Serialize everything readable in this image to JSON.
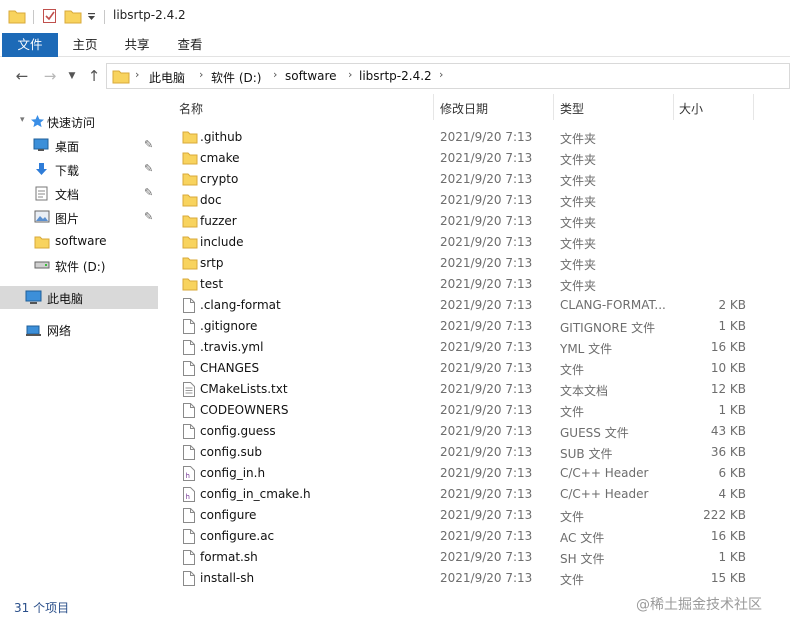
{
  "window": {
    "title": "libsrtp-2.4.2"
  },
  "ribbon": {
    "tabs": [
      "文件",
      "主页",
      "共享",
      "查看"
    ]
  },
  "address": {
    "crumbs": [
      "此电脑",
      "软件 (D:)",
      "software",
      "libsrtp-2.4.2"
    ]
  },
  "sidebar": {
    "quick_access": "快速访问",
    "items": [
      {
        "label": "桌面",
        "icon": "desktop-icon",
        "pinned": true
      },
      {
        "label": "下载",
        "icon": "download-icon",
        "pinned": true
      },
      {
        "label": "文档",
        "icon": "document-icon",
        "pinned": true
      },
      {
        "label": "图片",
        "icon": "picture-icon",
        "pinned": true
      },
      {
        "label": "software",
        "icon": "folder-icon",
        "pinned": false
      },
      {
        "label": "软件 (D:)",
        "icon": "drive-icon",
        "pinned": false
      }
    ],
    "this_pc": "此电脑",
    "network": "网络"
  },
  "columns": {
    "name": "名称",
    "date": "修改日期",
    "type": "类型",
    "size": "大小"
  },
  "files": [
    {
      "name": ".github",
      "date": "2021/9/20 7:13",
      "type": "文件夹",
      "size": "",
      "kind": "folder"
    },
    {
      "name": "cmake",
      "date": "2021/9/20 7:13",
      "type": "文件夹",
      "size": "",
      "kind": "folder"
    },
    {
      "name": "crypto",
      "date": "2021/9/20 7:13",
      "type": "文件夹",
      "size": "",
      "kind": "folder"
    },
    {
      "name": "doc",
      "date": "2021/9/20 7:13",
      "type": "文件夹",
      "size": "",
      "kind": "folder"
    },
    {
      "name": "fuzzer",
      "date": "2021/9/20 7:13",
      "type": "文件夹",
      "size": "",
      "kind": "folder"
    },
    {
      "name": "include",
      "date": "2021/9/20 7:13",
      "type": "文件夹",
      "size": "",
      "kind": "folder"
    },
    {
      "name": "srtp",
      "date": "2021/9/20 7:13",
      "type": "文件夹",
      "size": "",
      "kind": "folder"
    },
    {
      "name": "test",
      "date": "2021/9/20 7:13",
      "type": "文件夹",
      "size": "",
      "kind": "folder"
    },
    {
      "name": ".clang-format",
      "date": "2021/9/20 7:13",
      "type": "CLANG-FORMAT...",
      "size": "2 KB",
      "kind": "file"
    },
    {
      "name": ".gitignore",
      "date": "2021/9/20 7:13",
      "type": "GITIGNORE 文件",
      "size": "1 KB",
      "kind": "file"
    },
    {
      "name": ".travis.yml",
      "date": "2021/9/20 7:13",
      "type": "YML 文件",
      "size": "16 KB",
      "kind": "file"
    },
    {
      "name": "CHANGES",
      "date": "2021/9/20 7:13",
      "type": "文件",
      "size": "10 KB",
      "kind": "file"
    },
    {
      "name": "CMakeLists.txt",
      "date": "2021/9/20 7:13",
      "type": "文本文档",
      "size": "12 KB",
      "kind": "text"
    },
    {
      "name": "CODEOWNERS",
      "date": "2021/9/20 7:13",
      "type": "文件",
      "size": "1 KB",
      "kind": "file"
    },
    {
      "name": "config.guess",
      "date": "2021/9/20 7:13",
      "type": "GUESS 文件",
      "size": "43 KB",
      "kind": "file"
    },
    {
      "name": "config.sub",
      "date": "2021/9/20 7:13",
      "type": "SUB 文件",
      "size": "36 KB",
      "kind": "file"
    },
    {
      "name": "config_in.h",
      "date": "2021/9/20 7:13",
      "type": "C/C++ Header",
      "size": "6 KB",
      "kind": "header"
    },
    {
      "name": "config_in_cmake.h",
      "date": "2021/9/20 7:13",
      "type": "C/C++ Header",
      "size": "4 KB",
      "kind": "header"
    },
    {
      "name": "configure",
      "date": "2021/9/20 7:13",
      "type": "文件",
      "size": "222 KB",
      "kind": "file"
    },
    {
      "name": "configure.ac",
      "date": "2021/9/20 7:13",
      "type": "AC 文件",
      "size": "16 KB",
      "kind": "file"
    },
    {
      "name": "format.sh",
      "date": "2021/9/20 7:13",
      "type": "SH 文件",
      "size": "1 KB",
      "kind": "file"
    },
    {
      "name": "install-sh",
      "date": "2021/9/20 7:13",
      "type": "文件",
      "size": "15 KB",
      "kind": "file"
    }
  ],
  "status": {
    "count": "31 个项目"
  },
  "watermark": "@稀土掘金技术社区",
  "colors": {
    "accent": "#1d6ab7",
    "folder": "#f8d35e",
    "selected": "#d9d9d9"
  }
}
